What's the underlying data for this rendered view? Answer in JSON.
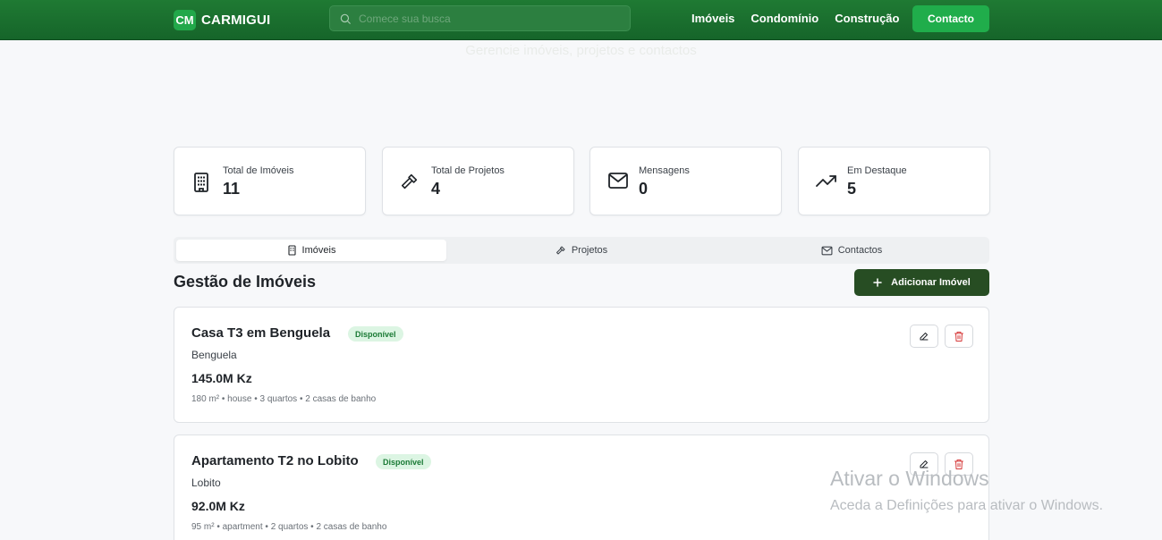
{
  "header": {
    "brand_badge": "CM",
    "brand_name": "CARMIGUI",
    "search_placeholder": "Comece sua busca",
    "nav": [
      "Imóveis",
      "Condomínio",
      "Construção"
    ],
    "contact_label": "Contacto"
  },
  "hero": {
    "subtitle": "Gerencie imóveis, projetos e contactos"
  },
  "stats": [
    {
      "label": "Total de Imóveis",
      "value": "11",
      "icon": "building-icon"
    },
    {
      "label": "Total de Projetos",
      "value": "4",
      "icon": "hammer-icon"
    },
    {
      "label": "Mensagens",
      "value": "0",
      "icon": "mail-icon"
    },
    {
      "label": "Em Destaque",
      "value": "5",
      "icon": "trending-up-icon"
    }
  ],
  "tabs": [
    {
      "label": "Imóveis",
      "icon": "building-icon",
      "active": true
    },
    {
      "label": "Projetos",
      "icon": "hammer-icon",
      "active": false
    },
    {
      "label": "Contactos",
      "icon": "mail-icon",
      "active": false
    }
  ],
  "section": {
    "title": "Gestão de Imóveis",
    "add_label": "Adicionar Imóvel"
  },
  "properties": [
    {
      "title": "Casa T3 em Benguela",
      "status": "Disponível",
      "location": "Benguela",
      "price": "145.0M Kz",
      "meta": "180 m² • house • 3 quartos • 2 casas de banho"
    },
    {
      "title": "Apartamento T2 no Lobito",
      "status": "Disponível",
      "location": "Lobito",
      "price": "92.0M Kz",
      "meta": "95 m² • apartment • 2 quartos • 2 casas de banho"
    }
  ],
  "watermark": {
    "title": "Ativar o Windows",
    "subtitle": "Aceda a Definições para ativar o Windows."
  },
  "colors": {
    "header_green": "#1f7a33",
    "contact_green": "#20ad4b",
    "add_button": "#274d23",
    "badge_bg": "#dcf5e3",
    "badge_text": "#1a7a35",
    "delete_red": "#d63a3a"
  }
}
